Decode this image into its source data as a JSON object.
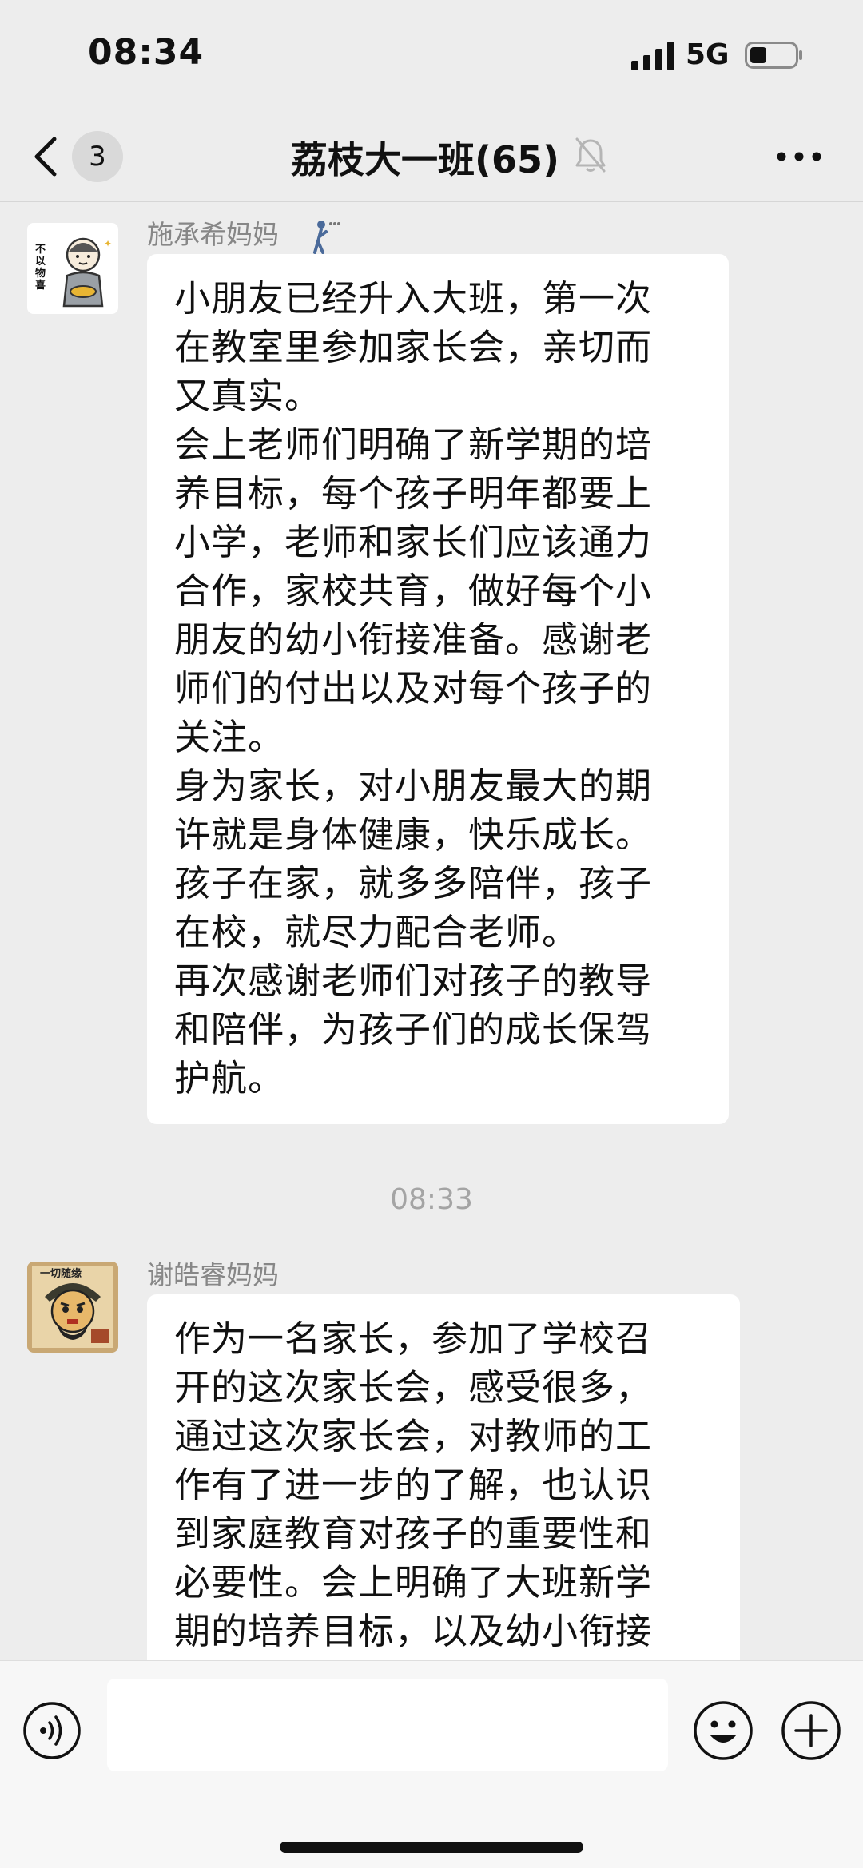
{
  "status_bar": {
    "time": "08:34",
    "network": "5G"
  },
  "nav": {
    "back_badge": "3",
    "title": "荔枝大一班(65)"
  },
  "messages": [
    {
      "sender": "施承希妈妈",
      "text": "小朋友已经升入大班，第一次\n在教室里参加家长会，亲切而\n又真实。\n会上老师们明确了新学期的培\n养目标，每个孩子明年都要上\n小学，老师和家长们应该通力\n合作，家校共育，做好每个小\n朋友的幼小衔接准备。感谢老\n师们的付出以及对每个孩子的\n关注。\n身为家长，对小朋友最大的期\n许就是身体健康，快乐成长。\n孩子在家，就多多陪伴，孩子\n在校，就尽力配合老师。\n再次感谢老师们对孩子的教导\n和陪伴，为孩子们的成长保驾\n护航。",
      "avatar_text": "不以物喜"
    },
    {
      "sender": "谢皓睿妈妈",
      "text": "作为一名家长，参加了学校召\n开的这次家长会，感受很多，\n通过这次家长会，对教师的工\n作有了进一步的了解，也认识\n到家庭教育对孩子的重要性和\n必要性。会上明确了大班新学\n期的培养目标，以及幼小衔接",
      "avatar_text": "一切随缘"
    }
  ],
  "time_divider": "08:33",
  "input": {
    "value": "",
    "placeholder": ""
  },
  "colors": {
    "background": "#ededed",
    "bubble": "#ffffff",
    "name_text": "#878787",
    "input_bar": "#f7f7f7"
  },
  "icons": {
    "back": "chevron-left-icon",
    "mute": "bell-slash-icon",
    "more": "more-dots-icon",
    "voice": "voice-icon",
    "emoji": "emoji-icon",
    "plus": "plus-icon",
    "sender_status": "person-status-icon"
  }
}
